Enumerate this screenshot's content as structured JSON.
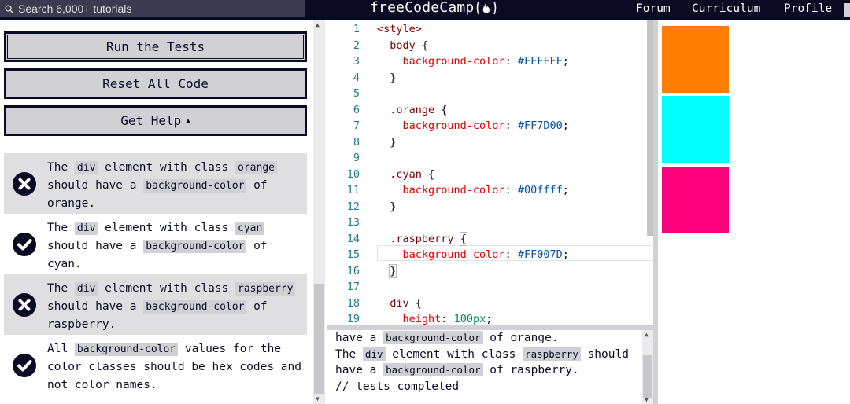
{
  "nav": {
    "search_placeholder": "Search 6,000+ tutorials",
    "brand": "freeCodeCamp",
    "links": [
      "Forum",
      "Curriculum",
      "Profile"
    ]
  },
  "buttons": {
    "run": "Run the Tests",
    "reset": "Reset All Code",
    "help": "Get Help"
  },
  "tests": [
    {
      "status": "fail",
      "p1": "The ",
      "c1": "div",
      "p2": " element with class ",
      "c2": "orange",
      "p3": " should have a ",
      "c3": "background-color",
      "p4": " of orange."
    },
    {
      "status": "pass",
      "p1": "The ",
      "c1": "div",
      "p2": " element with class ",
      "c2": "cyan",
      "p3": " should have a ",
      "c3": "background-color",
      "p4": " of cyan."
    },
    {
      "status": "fail",
      "p1": "The ",
      "c1": "div",
      "p2": " element with class ",
      "c2": "raspberry",
      "p3": " should have a ",
      "c3": "background-color",
      "p4": " of raspberry."
    },
    {
      "status": "pass",
      "p1": "All ",
      "c1": "background-color",
      "p2": " values for the color classes should be hex codes and not color names."
    }
  ],
  "editor": {
    "line_numbers": [
      "1",
      "2",
      "3",
      "4",
      "5",
      "6",
      "7",
      "8",
      "9",
      "10",
      "11",
      "12",
      "13",
      "14",
      "15",
      "16",
      "17",
      "18",
      "19"
    ],
    "code": {
      "l1": "<style>",
      "l2_sel": "body",
      "l2_br": " {",
      "l3_prop": "background-color",
      "l3_val": "#FFFFFF",
      "l6_sel": ".orange",
      "l6_br": " {",
      "l7_prop": "background-color",
      "l7_val": "#FF7D00",
      "l10_sel": ".cyan",
      "l10_br": " {",
      "l11_prop": "background-color",
      "l11_val": "#00ffff",
      "l14_sel": ".raspberry",
      "l14_br": "{",
      "l15_prop": "background-color",
      "l15_val": "#FF007D",
      "l18_sel": "div",
      "l18_br": " {",
      "l19_prop": "height",
      "l19_val": "100px",
      "close": "}"
    }
  },
  "console": {
    "l1_a": "have a ",
    "l1_code": "background-color",
    "l1_b": " of orange.",
    "l2_a": "The ",
    "l2_code1": "div",
    "l2_b": " element with class ",
    "l2_code2": "raspberry",
    "l2_c": " should",
    "l3_a": "have a ",
    "l3_code": "background-color",
    "l3_b": " of raspberry.",
    "l4": "// tests completed"
  },
  "preview": {
    "swatches": [
      {
        "name": "orange",
        "color": "#FF7D00"
      },
      {
        "name": "cyan",
        "color": "#00FFFF"
      },
      {
        "name": "raspberry",
        "color": "#FF007D"
      }
    ]
  }
}
